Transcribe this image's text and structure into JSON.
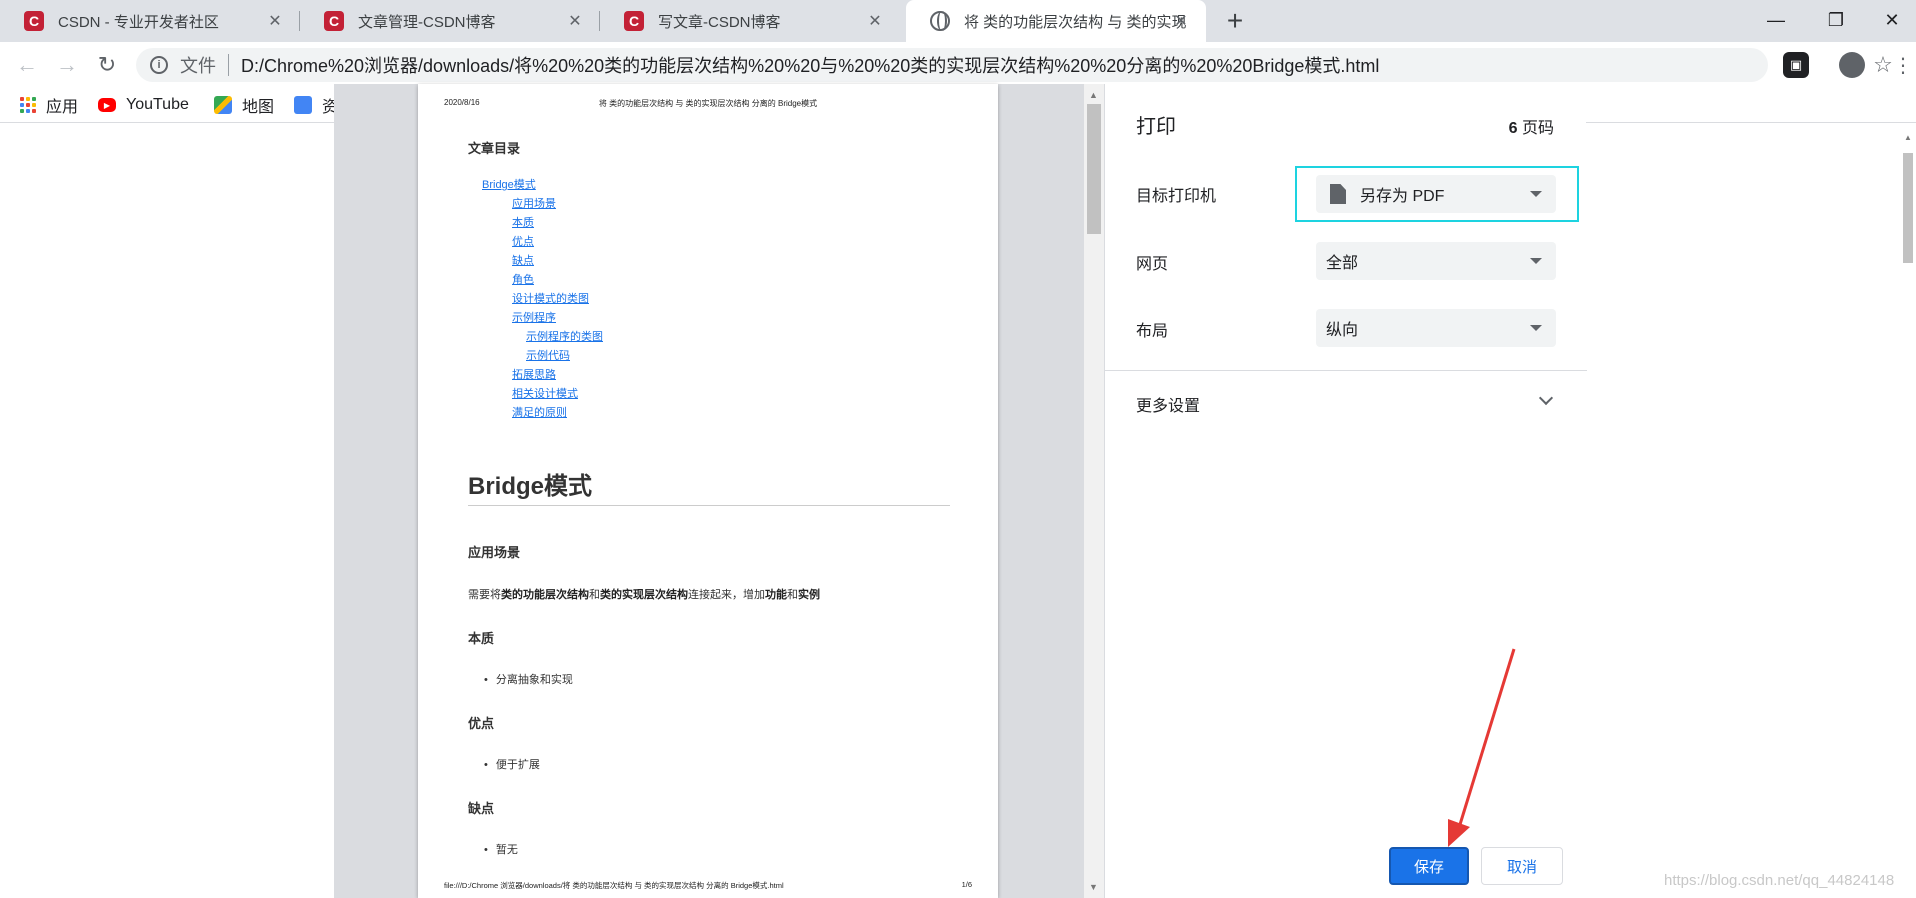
{
  "tabs": [
    {
      "title": "CSDN - 专业开发者社区",
      "favicon": "csdn-logo",
      "active": false
    },
    {
      "title": "文章管理-CSDN博客",
      "favicon": "csdn-logo",
      "active": false
    },
    {
      "title": "写文章-CSDN博客",
      "favicon": "csdn-logo",
      "active": false
    },
    {
      "title": "将 类的功能层次结构 与 类的实现",
      "favicon": "globe-icon",
      "active": true
    }
  ],
  "toolbar": {
    "scheme_label": "文件",
    "url": "D:/Chrome%20浏览器/downloads/将%20%20类的功能层次结构%20%20与%20%20类的实现层次结构%20%20分离的%20%20Bridge模式.html"
  },
  "bookmarks": [
    {
      "label": "应用",
      "icon": "apps-grid-icon"
    },
    {
      "label": "YouTube",
      "icon": "youtube-icon"
    },
    {
      "label": "地图",
      "icon": "maps-icon"
    },
    {
      "label": "资",
      "icon": "translate-icon"
    }
  ],
  "page": {
    "header_date": "2020/8/16",
    "header_title": "将 类的功能层次结构 与 类的实现层次结构 分离的 Bridge模式",
    "toc_heading": "文章目录",
    "toc": [
      {
        "label": "Bridge模式",
        "level": 1
      },
      {
        "label": "应用场景",
        "level": 2
      },
      {
        "label": "本质",
        "level": 2
      },
      {
        "label": "优点",
        "level": 2
      },
      {
        "label": "缺点",
        "level": 2
      },
      {
        "label": "角色",
        "level": 2
      },
      {
        "label": "设计模式的类图",
        "level": 2
      },
      {
        "label": "示例程序",
        "level": 2
      },
      {
        "label": "示例程序的类图",
        "level": 3
      },
      {
        "label": "示例代码",
        "level": 3
      },
      {
        "label": "拓展思路",
        "level": 2
      },
      {
        "label": "相关设计模式",
        "level": 2
      },
      {
        "label": "满足的原则",
        "level": 2
      }
    ],
    "h1": "Bridge模式",
    "sections": {
      "scene_heading": "应用场景",
      "scene_para": {
        "p1": "需要将",
        "b1": "类的功能层次结构",
        "p2": "和",
        "b2": "类的实现层次结构",
        "p3": "连接起来，增加",
        "b3": "功能",
        "p4": "和",
        "b4": "实例"
      },
      "essence_heading": "本质",
      "essence_item": "分离抽象和实现",
      "pros_heading": "优点",
      "pros_item": "便于扩展",
      "cons_heading": "缺点",
      "cons_item": "暂无"
    },
    "footer_url": "file:///D:/Chrome 浏览器/downloads/将 类的功能层次结构 与 类的实现层次结构 分离的 Bridge模式.html",
    "footer_page": "1/6"
  },
  "print_panel": {
    "title": "打印",
    "page_count_number": "6",
    "page_count_unit": "页码",
    "destination_label": "目标打印机",
    "destination_value": "另存为 PDF",
    "pages_label": "网页",
    "pages_value": "全部",
    "layout_label": "布局",
    "layout_value": "纵向",
    "more_settings": "更多设置",
    "save_button": "保存",
    "cancel_button": "取消"
  },
  "watermark": "https://blog.csdn.net/qq_44824148",
  "colors": {
    "accent": "#1a73e8",
    "highlight_box": "#1dd3e0",
    "annotation_arrow": "#e53935",
    "csdn_red": "#c32136"
  }
}
